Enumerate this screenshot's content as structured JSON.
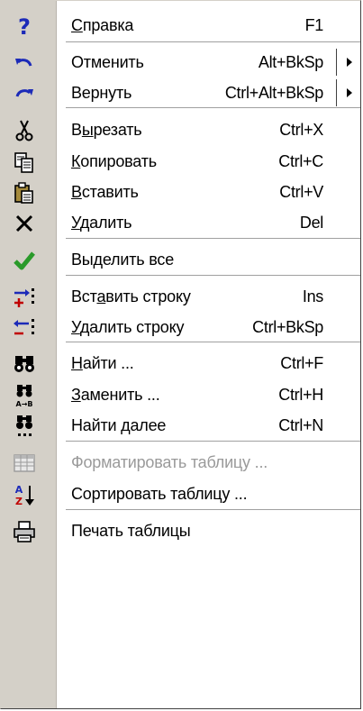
{
  "menu": {
    "items": [
      {
        "key": "help",
        "label": "Справка",
        "accel_index": 0,
        "shortcut": "F1",
        "icon": "help-icon"
      },
      {
        "key": "undo",
        "label": "Отменить",
        "accel_index": -1,
        "shortcut": "Alt+BkSp",
        "icon": "undo-icon",
        "submenu": true
      },
      {
        "key": "redo",
        "label": "Вернуть",
        "accel_index": -1,
        "shortcut": "Ctrl+Alt+BkSp",
        "icon": "redo-icon",
        "submenu": true
      },
      {
        "key": "cut",
        "label": "Вырезать",
        "accel_index": 1,
        "shortcut": "Ctrl+X",
        "icon": "scissors-icon"
      },
      {
        "key": "copy",
        "label": "Копировать",
        "accel_index": 0,
        "shortcut": "Ctrl+C",
        "icon": "copy-icon"
      },
      {
        "key": "paste",
        "label": "Вставить",
        "accel_index": 0,
        "shortcut": "Ctrl+V",
        "icon": "paste-icon"
      },
      {
        "key": "delete",
        "label": "Удалить",
        "accel_index": 0,
        "shortcut": "Del",
        "icon": "delete-icon"
      },
      {
        "key": "select-all",
        "label": "Выделить все",
        "accel_index": -1,
        "shortcut": "",
        "icon": "checkmark-icon"
      },
      {
        "key": "insert-row",
        "label": "Вставить строку",
        "accel_index": 3,
        "shortcut": "Ins",
        "icon": "insert-row-icon"
      },
      {
        "key": "delete-row",
        "label": "Удалить строку",
        "accel_index": 0,
        "shortcut": "Ctrl+BkSp",
        "icon": "delete-row-icon"
      },
      {
        "key": "find",
        "label": "Найти ...",
        "accel_index": 0,
        "shortcut": "Ctrl+F",
        "icon": "binoculars-icon"
      },
      {
        "key": "replace",
        "label": "Заменить ...",
        "accel_index": 0,
        "shortcut": "Ctrl+H",
        "icon": "replace-icon"
      },
      {
        "key": "find-next",
        "label": "Найти далее",
        "accel_index": 6,
        "shortcut": "Ctrl+N",
        "icon": "find-next-icon"
      },
      {
        "key": "format-table",
        "label": "Форматировать таблицу ...",
        "accel_index": -1,
        "shortcut": "",
        "icon": "table-icon",
        "disabled": true
      },
      {
        "key": "sort-table",
        "label": "Сортировать таблицу ...",
        "accel_index": -1,
        "shortcut": "",
        "icon": "sort-az-icon"
      },
      {
        "key": "print-table",
        "label": "Печать таблицы",
        "accel_index": -1,
        "shortcut": "",
        "icon": "printer-icon"
      }
    ]
  },
  "colors": {
    "strip": "#d4d0c8",
    "disabled_text": "#9a9a9a",
    "help_icon": "#1c2ab8",
    "checkmark": "#2a9a2a",
    "arrows": "#1c2ab8"
  }
}
